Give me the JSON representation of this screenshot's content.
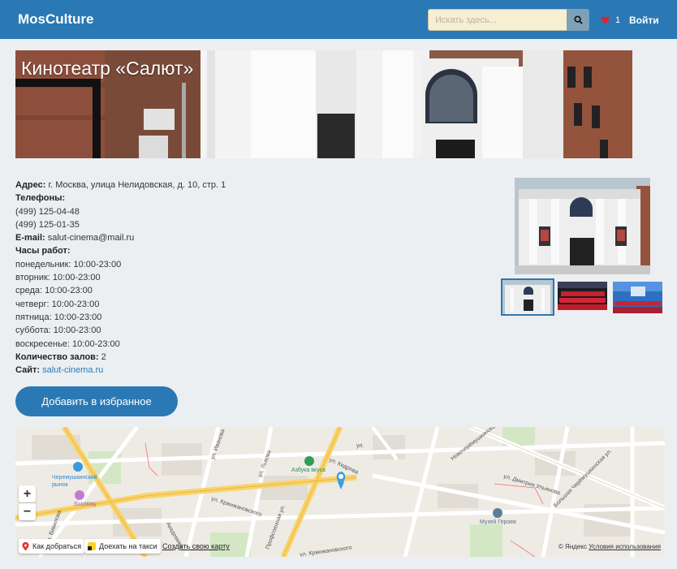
{
  "navbar": {
    "brand": "MosCulture",
    "search_placeholder": "Искать здесь...",
    "favorites_count": "1",
    "login": "Войти"
  },
  "page": {
    "title": "Кинотеатр «Салют»"
  },
  "info": {
    "address_label": "Адрес:",
    "address_value": "г. Москва, улица Нелидовская, д. 10, стр. 1",
    "phones_label": "Телефоны:",
    "phones": [
      "(499) 125-04-48",
      "(499) 125-01-35"
    ],
    "email_label": "E-mail:",
    "email_value": "salut-cinema@mail.ru",
    "hours_label": "Часы работ:",
    "hours": [
      "понедельник: 10:00-23:00",
      "вторник: 10:00-23:00",
      "среда: 10:00-23:00",
      "четверг: 10:00-23:00",
      "пятница: 10:00-23:00",
      "суббота: 10:00-23:00",
      "воскресенье: 10:00-23:00"
    ],
    "halls_label": "Количество залов:",
    "halls_value": "2",
    "site_label": "Сайт:",
    "site_value": "salut-cinema.ru"
  },
  "actions": {
    "add_favorite": "Добавить в избранное"
  },
  "map": {
    "labels": {
      "market": "Черемушкинский рынок",
      "soloway": "SoloWay",
      "azbuka": "Азбука вкуса",
      "museum": "Музей Героев",
      "krzh1": "ул. Кржижановского",
      "krzh2": "ул. Кржижановского",
      "kedrova": "ул. Кедрова",
      "ulyanova": "ул. Дмитрия Ульянова",
      "novocher": "Новочерёмушкинская",
      "bolcher": "Большая Черёмушкинская ул.",
      "ivanova": "ул. Иванова",
      "lvova": "ул. Львова",
      "vavilova": "ул. Вавилова",
      "akadem": "Академика",
      "profs": "Профсоюзная ул.",
      "ul": "ул."
    },
    "route_button": "Как добраться",
    "taxi_button": "Доехать на такси",
    "create_map": "Создать свою карту",
    "copyright": "© Яндекс",
    "terms": "Условия использования"
  }
}
